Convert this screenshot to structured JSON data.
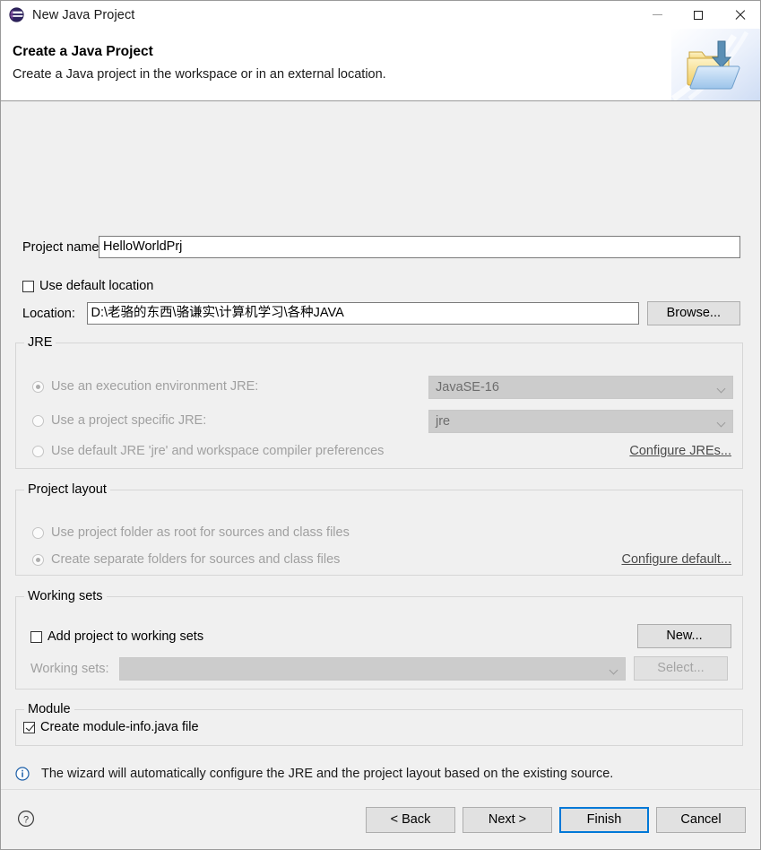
{
  "window": {
    "title": "New Java Project",
    "app_icon": "eclipse-icon",
    "controls": {
      "minimize": "minimize-icon",
      "maximize": "maximize-icon",
      "close": "close-icon"
    }
  },
  "banner": {
    "title": "Create a Java Project",
    "subtitle": "Create a Java project in the workspace or in an external location.",
    "image": "new-java-project-folder-icon"
  },
  "form": {
    "project_name_label": "Project name:",
    "project_name_value": "HelloWorldPrj",
    "project_name_placeholder": "",
    "use_default_location_label": "Use default location",
    "use_default_location_checked": false,
    "location_label": "Location:",
    "location_value": "D:\\老骆的东西\\骆谦实\\计算机学习\\各种JAVA",
    "location_placeholder": "",
    "browse_label": "Browse..."
  },
  "jre": {
    "group_title": "JRE",
    "options": [
      {
        "label": "Use an execution environment JRE:",
        "selected": true,
        "enabled": false
      },
      {
        "label": "Use a project specific JRE:",
        "selected": false,
        "enabled": false
      },
      {
        "label": "Use default JRE 'jre' and workspace compiler preferences",
        "selected": false,
        "enabled": false
      }
    ],
    "execution_env_value": "JavaSE-16",
    "project_jre_value": "jre",
    "configure_link": "Configure JREs..."
  },
  "project_layout": {
    "group_title": "Project layout",
    "options": [
      {
        "label": "Use project folder as root for sources and class files",
        "selected": false,
        "enabled": false
      },
      {
        "label": "Create separate folders for sources and class files",
        "selected": true,
        "enabled": false
      }
    ],
    "configure_link": "Configure default..."
  },
  "working_sets": {
    "group_title": "Working sets",
    "add_label": "Add project to working sets",
    "add_checked": false,
    "sets_label": "Working sets:",
    "sets_value": "",
    "new_label": "New...",
    "select_label": "Select..."
  },
  "module": {
    "group_title": "Module",
    "create_module_info_label": "Create module-info.java file",
    "create_module_info_checked": true
  },
  "status": {
    "icon": "info-icon",
    "message": "The wizard will automatically configure the JRE and the project layout based on the existing source."
  },
  "footer": {
    "help_icon": "help-icon",
    "buttons": [
      {
        "label": "< Back",
        "name": "back-button",
        "state": "normal"
      },
      {
        "label": "Next >",
        "name": "next-button",
        "state": "normal"
      },
      {
        "label": "Finish",
        "name": "finish-button",
        "state": "default"
      },
      {
        "label": "Cancel",
        "name": "cancel-button",
        "state": "normal"
      }
    ]
  },
  "colors": {
    "dialog_bg": "#f0f0f0",
    "accent": "#0078d7",
    "info_blue": "#1c5fa8",
    "disabled_text": "#a0a0a0",
    "link": "#4a4a4a"
  }
}
